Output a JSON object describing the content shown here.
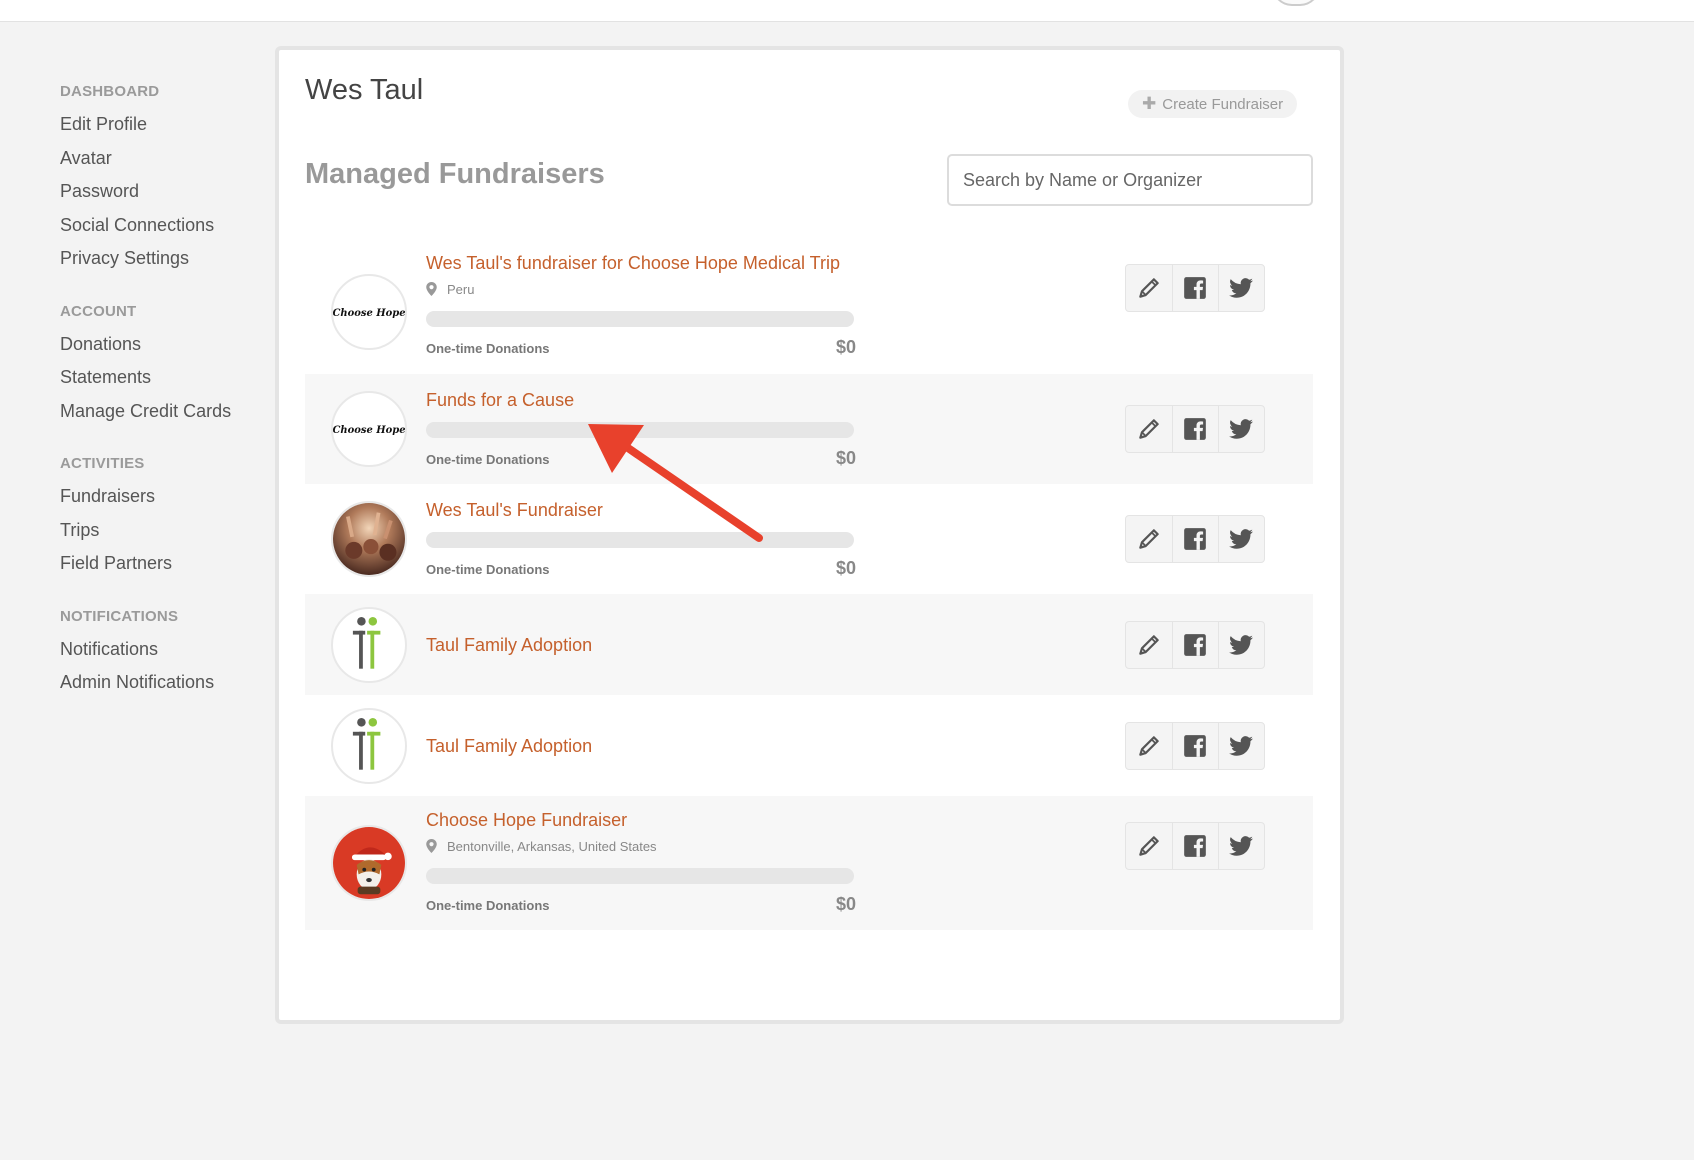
{
  "sidebar": {
    "sections": [
      {
        "heading": "DASHBOARD",
        "items": [
          "Edit Profile",
          "Avatar",
          "Password",
          "Social Connections",
          "Privacy Settings"
        ]
      },
      {
        "heading": "ACCOUNT",
        "items": [
          "Donations",
          "Statements",
          "Manage Credit Cards"
        ]
      },
      {
        "heading": "ACTIVITIES",
        "items": [
          "Fundraisers",
          "Trips",
          "Field Partners"
        ]
      },
      {
        "heading": "NOTIFICATIONS",
        "items": [
          "Notifications",
          "Admin Notifications"
        ]
      }
    ]
  },
  "header": {
    "user_name": "Wes Taul",
    "create_label": "Create Fundraiser",
    "section_title": "Managed Fundraisers",
    "search_placeholder": "Search by Name or Organizer"
  },
  "fundraisers": [
    {
      "title": "Wes Taul's fundraiser for Choose Hope Medical Trip",
      "location": "Peru",
      "has_progress": true,
      "progress_label": "One-time Donations",
      "amount": "$0",
      "progress_fraction": 0,
      "avatar": "choose-hope-logo",
      "logo_text": "Choose Hope"
    },
    {
      "title": "Funds for a Cause",
      "location": "",
      "has_progress": true,
      "progress_label": "One-time Donations",
      "amount": "$0",
      "progress_fraction": 0,
      "avatar": "choose-hope-logo",
      "logo_text": "Choose Hope"
    },
    {
      "title": "Wes Taul's Fundraiser",
      "location": "",
      "has_progress": true,
      "progress_label": "One-time Donations",
      "amount": "$0",
      "progress_fraction": 0,
      "avatar": "crowd-photo"
    },
    {
      "title": "Taul Family Adoption",
      "location": "",
      "has_progress": false,
      "avatar": "tt-logo"
    },
    {
      "title": "Taul Family Adoption",
      "location": "",
      "has_progress": false,
      "avatar": "tt-logo"
    },
    {
      "title": "Choose Hope Fundraiser",
      "location": "Bentonville, Arkansas, United States",
      "has_progress": true,
      "progress_label": "One-time Donations",
      "amount": "$0",
      "progress_fraction": 0,
      "avatar": "dog-santa-photo"
    }
  ],
  "icons": {
    "edit": "pencil-icon",
    "facebook": "facebook-icon",
    "twitter": "twitter-icon",
    "plus": "plus-icon",
    "location": "map-pin-icon",
    "annotation": "red-arrow-annotation"
  },
  "colors": {
    "accent": "#c5602c",
    "annotation": "#e8412c",
    "progress_track": "#e6e6e6",
    "row_alt": "#f7f7f7"
  }
}
